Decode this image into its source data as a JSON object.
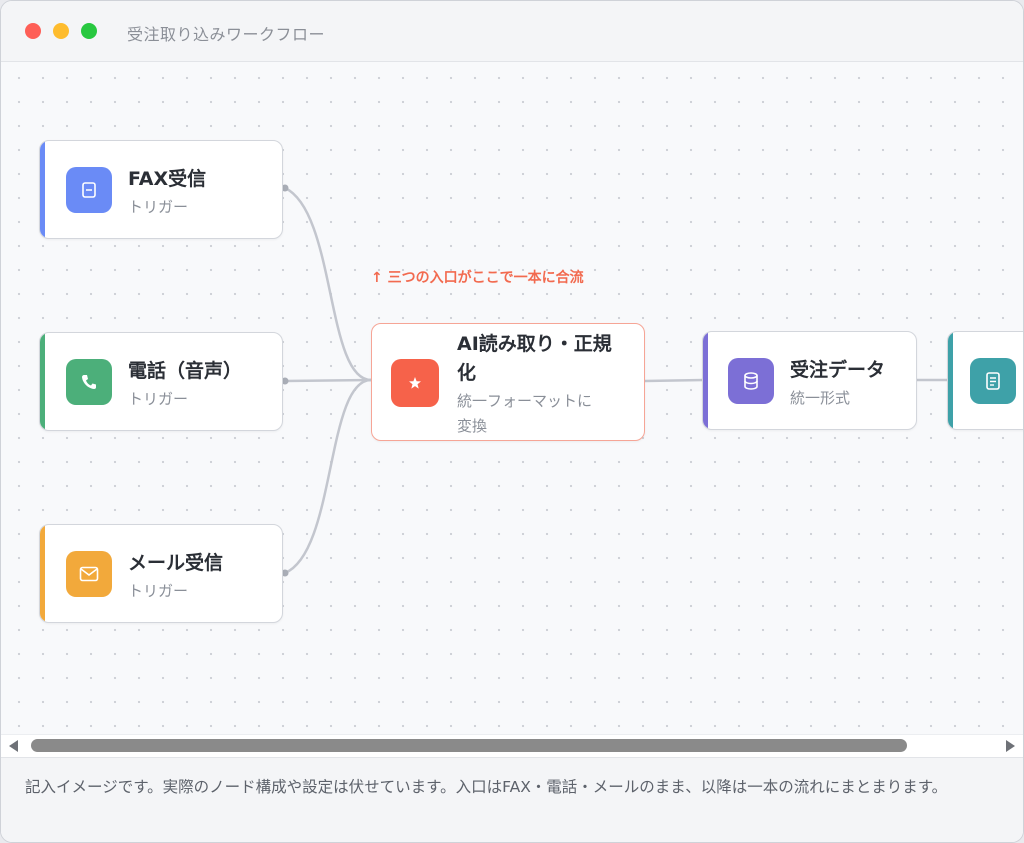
{
  "window": {
    "title": "受注取り込みワークフロー"
  },
  "annotation": "↑ 三つの入口がここで一本に合流",
  "nodes": {
    "fax": {
      "title": "FAX受信",
      "subtitle": "トリガー",
      "color": "#6a8bf6",
      "icon": "fax-icon"
    },
    "phone": {
      "title": "電話（音声）",
      "subtitle": "トリガー",
      "color": "#4caf7a",
      "icon": "phone-icon"
    },
    "mail": {
      "title": "メール受信",
      "subtitle": "トリガー",
      "color": "#f2a93b",
      "icon": "mail-icon"
    },
    "ai": {
      "title_line1": "AI読み取り・正規",
      "title_line2": "化",
      "subtitle_line1": "統一フォーマットに",
      "subtitle_line2": "変換",
      "color": "#f6624a",
      "icon": "sparkle-icon"
    },
    "order": {
      "title": "受注データ",
      "subtitle": "統一形式",
      "color": "#7c6fd6",
      "icon": "database-icon"
    },
    "document": {
      "color": "#3ea1a8",
      "icon": "document-icon"
    }
  },
  "footer": {
    "note": "記入イメージです。実際のノード構成や設定は伏せています。入口はFAX・電話・メールのまま、以降は一本の流れにまとまります。"
  }
}
